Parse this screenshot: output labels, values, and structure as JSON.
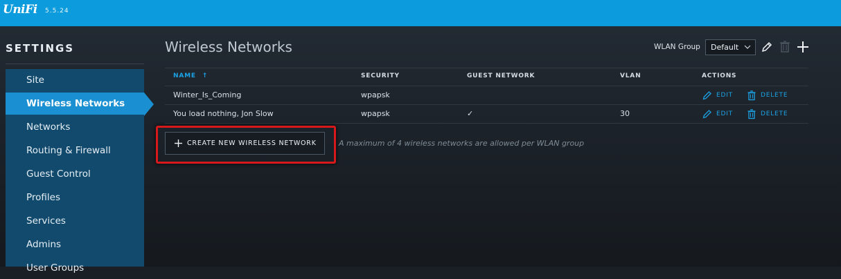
{
  "app": {
    "logo": "UniFi",
    "version": "5.5.24"
  },
  "sidebar": {
    "title": "SETTINGS",
    "items": [
      {
        "label": "Site"
      },
      {
        "label": "Wireless Networks",
        "active": true
      },
      {
        "label": "Networks"
      },
      {
        "label": "Routing & Firewall"
      },
      {
        "label": "Guest Control"
      },
      {
        "label": "Profiles"
      },
      {
        "label": "Services"
      },
      {
        "label": "Admins"
      },
      {
        "label": "User Groups"
      }
    ]
  },
  "main": {
    "title": "Wireless Networks",
    "wlan_group": {
      "label": "WLAN Group",
      "value": "Default"
    },
    "header_icons": [
      "pencil-icon",
      "trash-icon",
      "plus-icon"
    ],
    "table": {
      "columns": [
        "NAME",
        "SECURITY",
        "GUEST NETWORK",
        "VLAN",
        "ACTIONS"
      ],
      "sort_indicator": "↑",
      "rows": [
        {
          "name": "Winter_Is_Coming",
          "security": "wpapsk",
          "guest": "",
          "vlan": ""
        },
        {
          "name": "You load nothing, Jon Slow",
          "security": "wpapsk",
          "guest": "✓",
          "vlan": "30"
        }
      ],
      "actions": {
        "edit": "EDIT",
        "delete": "DELETE"
      }
    },
    "create_button": "CREATE NEW WIRELESS NETWORK",
    "note": "A maximum of 4 wireless networks are allowed per WLAN group"
  },
  "colors": {
    "topbar": "#0c9bdc",
    "accent": "#1ba3e6",
    "sidebar": "#114a6d",
    "sidebar_active": "#1a8fd2",
    "highlight": "#d8191b"
  }
}
